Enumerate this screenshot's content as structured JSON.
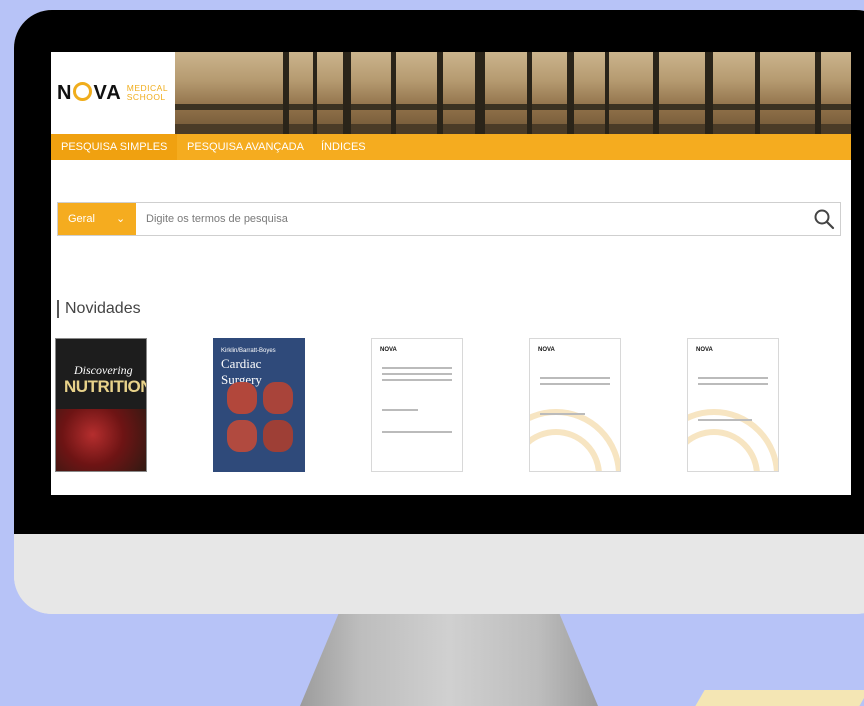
{
  "brand": {
    "logo_main": "NOVA",
    "logo_sub_1": "MEDICAL",
    "logo_sub_2": "SCHOOL"
  },
  "nav": {
    "items": [
      "PESQUISA SIMPLES",
      "PESQUISA AVANÇADA",
      "ÍNDICES"
    ],
    "active": "PESQUISA SIMPLES"
  },
  "search": {
    "scope": "Geral",
    "placeholder": "Digite os termos de pesquisa"
  },
  "section": {
    "title": "Novidades"
  },
  "covers": {
    "c1_title": "Discovering",
    "c1_title2": "NUTRITION",
    "c2_author": "Kirklin/Barratt-Boyes",
    "c2_title": "Cardiac Surgery",
    "c3_logo": "NOVA",
    "c4_logo": "NOVA",
    "c5_logo": "NOVA"
  },
  "colors": {
    "accent": "#f5ac1f",
    "background": "#b7c3f7"
  }
}
